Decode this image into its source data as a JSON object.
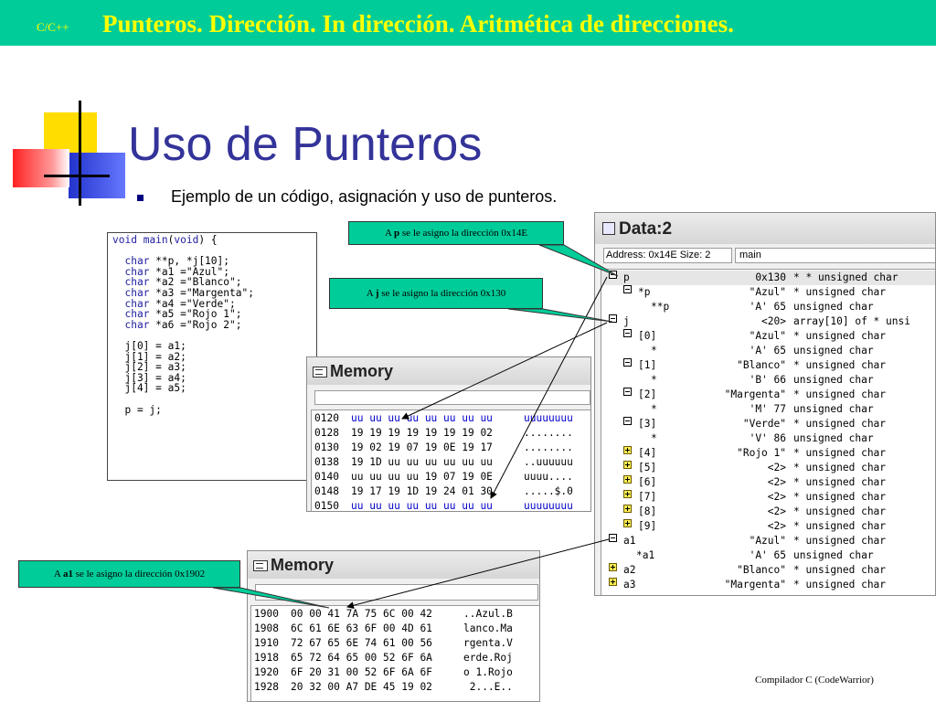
{
  "banner": {
    "tag": "C/C++",
    "title": "Punteros. Dirección. In dirección. Aritmética de direcciones."
  },
  "slide": {
    "title": "Uso de Punteros",
    "bullet": "Ejemplo de un código, asignación y uso de punteros."
  },
  "code": {
    "lines": [
      "void main(void) {",
      "",
      "  char **p, *j[10];",
      "  char *a1 =\"Azul\";",
      "  char *a2 =\"Blanco\";",
      "  char *a3 =\"Margenta\";",
      "  char *a4 =\"Verde\";",
      "  char *a5 =\"Rojo 1\";",
      "  char *a6 =\"Rojo 2\";",
      "",
      "  j[0] = a1;",
      "  j[1] = a2;",
      "  j[2] = a3;",
      "  j[3] = a4;",
      "  j[4] = a5;",
      "",
      "  p = j;"
    ]
  },
  "callouts": {
    "p": {
      "prefix": "A ",
      "var": "p",
      "suffix": " se le asigno la dirección 0x14E"
    },
    "j": {
      "prefix": "A ",
      "var": "j",
      "suffix": " se le asigno la dirección 0x130"
    },
    "a1": {
      "prefix": "A ",
      "var": "a1",
      "suffix": " se le asigno la dirección 0x1902"
    }
  },
  "memory1": {
    "title": "Memory",
    "rows": [
      {
        "addr": "0120",
        "hex": "uu uu uu uu uu uu uu uu",
        "ascii": "uuuuuuuu",
        "blue": true
      },
      {
        "addr": "0128",
        "hex": "19 19 19 19 19 19 19 02",
        "ascii": "........",
        "blue": false
      },
      {
        "addr": "0130",
        "hex": "19 02 19 07 19 0E 19 17",
        "ascii": "........",
        "blue": false
      },
      {
        "addr": "0138",
        "hex": "19 1D uu uu uu uu uu uu",
        "ascii": "..uuuuuu",
        "blue": false
      },
      {
        "addr": "0140",
        "hex": "uu uu uu uu 19 07 19 0E",
        "ascii": "uuuu....",
        "blue": false
      },
      {
        "addr": "0148",
        "hex": "19 17 19 1D 19 24 01 30",
        "ascii": ".....$.0",
        "blue": false
      },
      {
        "addr": "0150",
        "hex": "uu uu uu uu uu uu uu uu",
        "ascii": "uuuuuuuu",
        "blue": true
      }
    ]
  },
  "memory2": {
    "title": "Memory",
    "rows": [
      {
        "addr": "1900",
        "hex": "00 00 41 7A 75 6C 00 42",
        "ascii": "..Azul.B"
      },
      {
        "addr": "1908",
        "hex": "6C 61 6E 63 6F 00 4D 61",
        "ascii": "lanco.Ma"
      },
      {
        "addr": "1910",
        "hex": "72 67 65 6E 74 61 00 56",
        "ascii": "rgenta.V"
      },
      {
        "addr": "1918",
        "hex": "65 72 64 65 00 52 6F 6A",
        "ascii": "erde.Roj"
      },
      {
        "addr": "1920",
        "hex": "6F 20 31 00 52 6F 6A 6F",
        "ascii": "o 1.Rojo"
      },
      {
        "addr": "1928",
        "hex": "20 32 00 A7 DE 45 19 02",
        "ascii": " 2...E.."
      }
    ]
  },
  "data": {
    "title": "Data:2",
    "address_field": "Address: 0x14E Size: 2",
    "scope_field": "main",
    "rows": [
      {
        "indent": 0,
        "toggle": "minus",
        "name": "p",
        "value": "0x130",
        "type": "* * unsigned char",
        "highlight": true
      },
      {
        "indent": 1,
        "toggle": "minus",
        "name": "*p",
        "value": "\"Azul\"",
        "type": "* unsigned char"
      },
      {
        "indent": 2,
        "toggle": "",
        "name": "**p",
        "value": "'A' 65",
        "type": "unsigned char"
      },
      {
        "indent": 0,
        "toggle": "minus",
        "name": "j",
        "value": "<20>",
        "type": "array[10] of * unsi"
      },
      {
        "indent": 1,
        "toggle": "minus",
        "name": "[0]",
        "value": "\"Azul\"",
        "type": "* unsigned char"
      },
      {
        "indent": 2,
        "toggle": "",
        "name": "*",
        "value": "'A' 65",
        "type": "unsigned char"
      },
      {
        "indent": 1,
        "toggle": "minus",
        "name": "[1]",
        "value": "\"Blanco\"",
        "type": "* unsigned char"
      },
      {
        "indent": 2,
        "toggle": "",
        "name": "*",
        "value": "'B' 66",
        "type": "unsigned char"
      },
      {
        "indent": 1,
        "toggle": "minus",
        "name": "[2]",
        "value": "\"Margenta\"",
        "type": "* unsigned char"
      },
      {
        "indent": 2,
        "toggle": "",
        "name": "*",
        "value": "'M' 77",
        "type": "unsigned char"
      },
      {
        "indent": 1,
        "toggle": "minus",
        "name": "[3]",
        "value": "\"Verde\"",
        "type": "* unsigned char"
      },
      {
        "indent": 2,
        "toggle": "",
        "name": "*",
        "value": "'V' 86",
        "type": "unsigned char"
      },
      {
        "indent": 1,
        "toggle": "plus",
        "name": "[4]",
        "value": "\"Rojo 1\"",
        "type": "* unsigned char"
      },
      {
        "indent": 1,
        "toggle": "plus",
        "name": "[5]",
        "value": "<2>",
        "type": "* unsigned char"
      },
      {
        "indent": 1,
        "toggle": "plus",
        "name": "[6]",
        "value": "<2>",
        "type": "* unsigned char"
      },
      {
        "indent": 1,
        "toggle": "plus",
        "name": "[7]",
        "value": "<2>",
        "type": "* unsigned char"
      },
      {
        "indent": 1,
        "toggle": "plus",
        "name": "[8]",
        "value": "<2>",
        "type": "* unsigned char"
      },
      {
        "indent": 1,
        "toggle": "plus",
        "name": "[9]",
        "value": "<2>",
        "type": "* unsigned char"
      },
      {
        "indent": 0,
        "toggle": "minus",
        "name": "a1",
        "value": "\"Azul\"",
        "type": "* unsigned char"
      },
      {
        "indent": 1,
        "toggle": "",
        "name": "*a1",
        "value": "'A' 65",
        "type": "unsigned char"
      },
      {
        "indent": 0,
        "toggle": "plus",
        "name": "a2",
        "value": "\"Blanco\"",
        "type": "* unsigned char"
      },
      {
        "indent": 0,
        "toggle": "plus",
        "name": "a3",
        "value": "\"Margenta\"",
        "type": "* unsigned char"
      }
    ]
  },
  "footer": "Compilador C (CodeWarrior)",
  "colors": {
    "banner": "#00cc99",
    "banner_text": "#ffff00",
    "title": "#333399",
    "keyword": "#2020a0",
    "uninit_hex": "#0000cc"
  }
}
